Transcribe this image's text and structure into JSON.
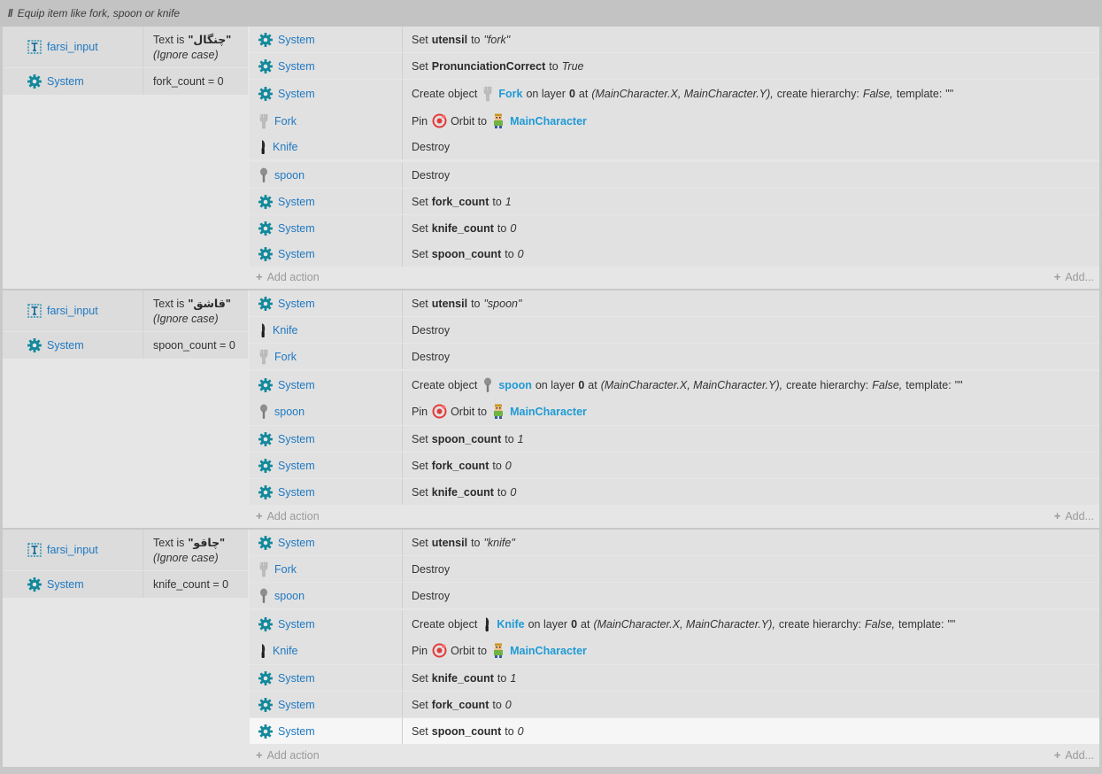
{
  "comment": {
    "slashes": "//",
    "text": "Equip item like fork, spoon or knife"
  },
  "add_action_label": "Add action",
  "add_more_label": "Add...",
  "labels": {
    "set": "Set",
    "to": "to",
    "create_object": "Create object",
    "on_layer": "on layer",
    "at": "at",
    "create_hierarchy": "create hierarchy:",
    "template": "template:",
    "destroy": "Destroy",
    "pin": "Pin",
    "orbit_to": "Orbit to",
    "text_is": "Text is",
    "ignore_case": "(Ignore case)"
  },
  "colors": {
    "link": "#1e78c2",
    "ref": "#1f9ad6",
    "gear": "#13899c",
    "block_bg": "#e6e6e6",
    "highlight": "#f6f6f6"
  },
  "blocks": [
    {
      "conditions": [
        {
          "object": "farsi_input",
          "icon": "text-input-icon",
          "text_is": "Text is",
          "value": "\"چنگال\"",
          "note": "(Ignore case)"
        },
        {
          "object": "System",
          "icon": "gear-icon",
          "expr": "fork_count = 0"
        }
      ],
      "actions": [
        {
          "object": "System",
          "icon": "gear-icon",
          "kind": "set",
          "var": "utensil",
          "val": "\"fork\""
        },
        {
          "object": "System",
          "icon": "gear-icon",
          "kind": "set",
          "var": "PronunciationCorrect",
          "val": "True"
        },
        {
          "object": "System",
          "icon": "gear-icon",
          "kind": "create",
          "target": "Fork",
          "target_icon": "fork-icon",
          "layer": "0",
          "pos": "(MainCharacter.X, MainCharacter.Y),",
          "hier": "False,",
          "tmpl": "\"\""
        },
        {
          "object": "Fork",
          "icon": "fork-icon",
          "kind": "pin",
          "target": "MainCharacter"
        },
        {
          "object": "Knife",
          "icon": "knife-icon",
          "kind": "destroy"
        },
        {
          "object": "spoon",
          "icon": "spoon-icon",
          "kind": "destroy"
        },
        {
          "object": "System",
          "icon": "gear-icon",
          "kind": "set",
          "var": "fork_count",
          "val": "1"
        },
        {
          "object": "System",
          "icon": "gear-icon",
          "kind": "set",
          "var": "knife_count",
          "val": "0"
        },
        {
          "object": "System",
          "icon": "gear-icon",
          "kind": "set",
          "var": "spoon_count",
          "val": "0"
        }
      ]
    },
    {
      "conditions": [
        {
          "object": "farsi_input",
          "icon": "text-input-icon",
          "text_is": "Text is",
          "value": "\"قاشق\"",
          "note": "(Ignore case)"
        },
        {
          "object": "System",
          "icon": "gear-icon",
          "expr": "spoon_count = 0"
        }
      ],
      "actions": [
        {
          "object": "System",
          "icon": "gear-icon",
          "kind": "set",
          "var": "utensil",
          "val": "\"spoon\""
        },
        {
          "object": "Knife",
          "icon": "knife-icon",
          "kind": "destroy"
        },
        {
          "object": "Fork",
          "icon": "fork-icon",
          "kind": "destroy"
        },
        {
          "object": "System",
          "icon": "gear-icon",
          "kind": "create",
          "target": "spoon",
          "target_icon": "spoon-icon",
          "layer": "0",
          "pos": "(MainCharacter.X, MainCharacter.Y),",
          "hier": "False,",
          "tmpl": "\"\""
        },
        {
          "object": "spoon",
          "icon": "spoon-icon",
          "kind": "pin",
          "target": "MainCharacter"
        },
        {
          "object": "System",
          "icon": "gear-icon",
          "kind": "set",
          "var": "spoon_count",
          "val": "1"
        },
        {
          "object": "System",
          "icon": "gear-icon",
          "kind": "set",
          "var": "fork_count",
          "val": "0"
        },
        {
          "object": "System",
          "icon": "gear-icon",
          "kind": "set",
          "var": "knife_count",
          "val": "0"
        }
      ]
    },
    {
      "conditions": [
        {
          "object": "farsi_input",
          "icon": "text-input-icon",
          "text_is": "Text is",
          "value": "\"چاقو\"",
          "note": "(Ignore case)"
        },
        {
          "object": "System",
          "icon": "gear-icon",
          "expr": "knife_count = 0"
        }
      ],
      "actions": [
        {
          "object": "System",
          "icon": "gear-icon",
          "kind": "set",
          "var": "utensil",
          "val": "\"knife\""
        },
        {
          "object": "Fork",
          "icon": "fork-icon",
          "kind": "destroy"
        },
        {
          "object": "spoon",
          "icon": "spoon-icon",
          "kind": "destroy"
        },
        {
          "object": "System",
          "icon": "gear-icon",
          "kind": "create",
          "target": "Knife",
          "target_icon": "knife-icon",
          "layer": "0",
          "pos": "(MainCharacter.X, MainCharacter.Y),",
          "hier": "False,",
          "tmpl": "\"\""
        },
        {
          "object": "Knife",
          "icon": "knife-icon",
          "kind": "pin",
          "target": "MainCharacter"
        },
        {
          "object": "System",
          "icon": "gear-icon",
          "kind": "set",
          "var": "knife_count",
          "val": "1"
        },
        {
          "object": "System",
          "icon": "gear-icon",
          "kind": "set",
          "var": "fork_count",
          "val": "0"
        },
        {
          "object": "System",
          "icon": "gear-icon",
          "kind": "set",
          "var": "spoon_count",
          "val": "0",
          "highlighted": true
        }
      ]
    }
  ]
}
